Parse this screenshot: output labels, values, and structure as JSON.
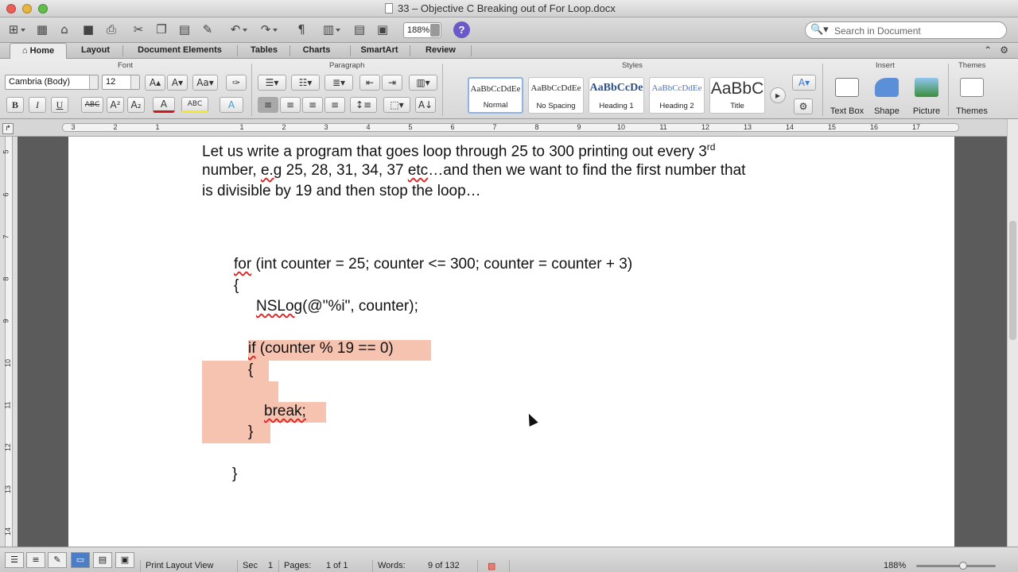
{
  "window": {
    "title": "33 – Objective C Breaking out of For Loop.docx"
  },
  "toolbar": {
    "zoom": "188%",
    "search_placeholder": "Search in Document"
  },
  "tabs": [
    "Home",
    "Layout",
    "Document Elements",
    "Tables",
    "Charts",
    "SmartArt",
    "Review"
  ],
  "active_tab": "Home",
  "ribbon": {
    "groups": {
      "font": "Font",
      "paragraph": "Paragraph",
      "styles": "Styles",
      "insert": "Insert",
      "themes": "Themes"
    },
    "font_name": "Cambria (Body)",
    "font_size": "12",
    "styles": [
      {
        "preview": "AaBbCcDdEe",
        "name": "Normal"
      },
      {
        "preview": "AaBbCcDdEe",
        "name": "No Spacing"
      },
      {
        "preview": "AaBbCcDe",
        "name": "Heading 1"
      },
      {
        "preview": "AaBbCcDdEe",
        "name": "Heading 2"
      },
      {
        "preview": "AaBbC",
        "name": "Title"
      }
    ],
    "insert_items": [
      "Text Box",
      "Shape",
      "Picture"
    ],
    "themes_label": "Themes"
  },
  "ruler": {
    "numbers": [
      "3",
      "2",
      "1",
      "1",
      "2",
      "3",
      "4",
      "5",
      "6",
      "7",
      "8",
      "9",
      "10",
      "11",
      "12",
      "13",
      "14",
      "15",
      "16",
      "17"
    ]
  },
  "vruler": {
    "numbers": [
      "5",
      "6",
      "7",
      "8",
      "9",
      "10",
      "11",
      "12",
      "13",
      "14"
    ]
  },
  "document": {
    "para1_line1": "Let us write a program that goes loop through 25 to 300 printing out every 3",
    "para1_sup": "rd",
    "para1_line2_a": "number, ",
    "para1_line2_sq": "e.g",
    "para1_line2_b": " 25, 28, 31, 34, 37 ",
    "para1_line2_sq2": "etc",
    "para1_line2_c": "…and then we want to find the first number that",
    "para1_line3": "is divisible by 19 and then stop the loop…",
    "code": {
      "for_kw": "for",
      "for_rest": " (int counter = 25; counter <= 300; counter = counter + 3)",
      "open_brace": "{",
      "nslog_kw": "NSLog",
      "nslog_rest": "(@\"%i\", counter);",
      "if_kw": "if",
      "if_rest": " (counter % 19 == 0)",
      "inner_open": "{",
      "break_kw": "break;",
      "inner_close": "}",
      "close_brace": "}"
    }
  },
  "status": {
    "view": "Print Layout View",
    "sec_label": "Sec",
    "sec_value": "1",
    "pages_label": "Pages:",
    "pages_value": "1 of 1",
    "words_label": "Words:",
    "words_value": "9 of 132",
    "zoom": "188%"
  },
  "colors": {
    "highlight": "#f6c3b1",
    "accent": "#4c7dc7"
  }
}
